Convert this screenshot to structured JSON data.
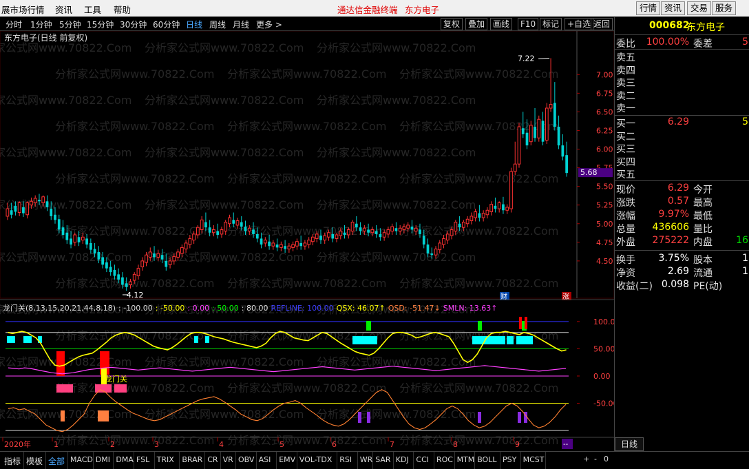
{
  "menu": {
    "items": [
      "展市场行情",
      "资讯",
      "工具",
      "帮助"
    ],
    "center_title": "通达信金融终端",
    "center_stock": "东方电子",
    "right_buttons": [
      "行情",
      "资讯",
      "交易",
      "服务"
    ]
  },
  "toolbar": {
    "periods": [
      "分时",
      "1分钟",
      "5分钟",
      "15分钟",
      "30分钟",
      "60分钟",
      "日线",
      "周线",
      "月线",
      "更多 >"
    ],
    "active_period": "日线",
    "tools": [
      "复权",
      "叠加",
      "画线",
      "F10",
      "标记",
      "+自选",
      "返回"
    ]
  },
  "chart": {
    "title": "东方电子(日线 前复权)",
    "watermark": "分析家公式网www.70822.Com",
    "price_high_label": "7.22",
    "price_low_label": "4.12",
    "price_axis": [
      "7.00",
      "6.75",
      "6.50",
      "6.25",
      "6.00",
      "5.75",
      "5.50",
      "5.25",
      "5.00",
      "4.75",
      "4.50"
    ],
    "current_price_tag": "5.68",
    "markers": {
      "cai": "财",
      "zhang": "涨"
    },
    "ind_name": "龙门关(8,13,15,20,21,44,8,18)",
    "ind_vals": [
      {
        "text": ": -100.00",
        "color": "#dddddd"
      },
      {
        "text": ": -50.00",
        "color": "#ffff00"
      },
      {
        "text": ": 0.00",
        "color": "#ff40ff"
      },
      {
        "text": ": 50.00",
        "color": "#00ff00"
      },
      {
        "text": ": 80.00",
        "color": "#dddddd"
      },
      {
        "text": "REFLINE: 100.00",
        "color": "#4040ff"
      },
      {
        "text": "QSX: 46.07↑",
        "color": "#ffff00"
      },
      {
        "text": "QSD: -51.47↓",
        "color": "#ff8040"
      },
      {
        "text": "SMLN: 13.63↑",
        "color": "#ff40ff"
      }
    ],
    "ind_axis": [
      "100.0",
      "50.00",
      "0.00",
      "-50.00"
    ],
    "ind_annotation": "龙门关",
    "time_axis": [
      "2020年",
      "1",
      "2",
      "3",
      "4",
      "5",
      "6",
      "7",
      "8",
      "9"
    ],
    "period_button": "日线",
    "zoom_controls": [
      "+",
      "-",
      "0"
    ],
    "more_button": "--"
  },
  "chart_data": {
    "type": "candlestick",
    "price_range": [
      4.12,
      7.22
    ],
    "price_axis_ticks": [
      4.5,
      4.75,
      5.0,
      5.25,
      5.5,
      5.75,
      6.0,
      6.25,
      6.5,
      6.75,
      7.0
    ],
    "indicator_axis_ticks": [
      -50,
      0,
      50,
      100
    ],
    "candles": [
      [
        5.1,
        5.28,
        5.2
      ],
      [
        5.18,
        5.28,
        5.12
      ],
      [
        5.24,
        5.3,
        5.16
      ],
      [
        5.15,
        5.3,
        5.28
      ],
      [
        5.22,
        5.3,
        5.14
      ],
      [
        5.12,
        5.3,
        5.28
      ],
      [
        5.25,
        5.35,
        5.3
      ],
      [
        5.28,
        5.38,
        5.34
      ],
      [
        5.32,
        5.4,
        5.3
      ],
      [
        5.28,
        5.38,
        5.36
      ],
      [
        5.3,
        5.38,
        5.22
      ],
      [
        5.2,
        5.3,
        5.1
      ],
      [
        5.12,
        5.22,
        5.05
      ],
      [
        5.06,
        5.12,
        4.92
      ],
      [
        4.95,
        5.05,
        4.85
      ],
      [
        4.88,
        4.98,
        4.78
      ],
      [
        4.8,
        4.9,
        4.72
      ],
      [
        4.75,
        4.88,
        4.85
      ],
      [
        4.82,
        4.9,
        4.75
      ],
      [
        4.78,
        4.88,
        4.82
      ],
      [
        4.8,
        4.86,
        4.72
      ],
      [
        4.74,
        4.8,
        4.65
      ],
      [
        4.66,
        4.74,
        4.6
      ],
      [
        4.62,
        4.7,
        4.52
      ],
      [
        4.55,
        4.62,
        4.45
      ],
      [
        4.48,
        4.55,
        4.4
      ],
      [
        4.42,
        4.5,
        4.35
      ],
      [
        4.38,
        4.45,
        4.3
      ],
      [
        4.32,
        4.4,
        4.25
      ],
      [
        4.28,
        4.35,
        4.18
      ],
      [
        4.2,
        4.28,
        4.15
      ],
      [
        4.18,
        4.26,
        4.22
      ],
      [
        4.24,
        4.35,
        4.32
      ],
      [
        4.3,
        4.45,
        4.4
      ],
      [
        4.42,
        4.55,
        4.5
      ],
      [
        4.48,
        4.62,
        4.58
      ],
      [
        4.55,
        4.68,
        4.62
      ],
      [
        4.6,
        4.7,
        4.55
      ],
      [
        4.55,
        4.65,
        4.6
      ],
      [
        4.58,
        4.66,
        4.52
      ],
      [
        4.5,
        4.6,
        4.42
      ],
      [
        4.45,
        4.55,
        4.5
      ],
      [
        4.5,
        4.6,
        4.56
      ],
      [
        4.55,
        4.66,
        4.62
      ],
      [
        4.6,
        4.72,
        4.68
      ],
      [
        4.66,
        4.78,
        4.74
      ],
      [
        4.72,
        4.85,
        4.8
      ],
      [
        4.78,
        4.9,
        4.86
      ],
      [
        4.85,
        4.98,
        4.95
      ],
      [
        4.92,
        5.1,
        5.05
      ],
      [
        5.02,
        5.15,
        4.95
      ],
      [
        4.95,
        5.05,
        4.88
      ],
      [
        4.88,
        4.98,
        4.92
      ],
      [
        4.9,
        5.0,
        4.85
      ],
      [
        4.86,
        4.96,
        4.92
      ],
      [
        4.9,
        5.05,
        5.02
      ],
      [
        5.0,
        5.12,
        5.08
      ],
      [
        5.05,
        5.15,
        5.0
      ],
      [
        4.98,
        5.08,
        5.04
      ],
      [
        5.02,
        5.1,
        4.96
      ],
      [
        4.96,
        5.04,
        4.9
      ],
      [
        4.9,
        4.98,
        4.94
      ],
      [
        4.92,
        5.02,
        4.86
      ],
      [
        4.86,
        4.95,
        4.8
      ],
      [
        4.8,
        4.88,
        4.72
      ],
      [
        4.74,
        4.82,
        4.78
      ],
      [
        4.76,
        4.85,
        4.7
      ],
      [
        4.7,
        4.78,
        4.74
      ],
      [
        4.72,
        4.8,
        4.68
      ],
      [
        4.68,
        4.76,
        4.72
      ],
      [
        4.7,
        4.78,
        4.66
      ],
      [
        4.66,
        4.74,
        4.7
      ],
      [
        4.68,
        4.76,
        4.72
      ],
      [
        4.7,
        4.8,
        4.76
      ],
      [
        4.74,
        4.84,
        4.7
      ],
      [
        4.7,
        4.78,
        4.74
      ],
      [
        4.72,
        4.82,
        4.78
      ],
      [
        4.76,
        4.86,
        4.82
      ],
      [
        4.8,
        4.9,
        4.86
      ],
      [
        4.84,
        4.92,
        4.78
      ],
      [
        4.78,
        4.88,
        4.84
      ],
      [
        4.82,
        4.92,
        4.88
      ],
      [
        4.86,
        4.95,
        4.8
      ],
      [
        4.8,
        4.88,
        4.85
      ],
      [
        4.84,
        4.94,
        4.9
      ],
      [
        4.88,
        4.98,
        4.85
      ],
      [
        4.85,
        4.95,
        4.92
      ],
      [
        4.9,
        5.05,
        5.02
      ],
      [
        5.0,
        5.1,
        4.95
      ],
      [
        4.95,
        5.02,
        4.9
      ],
      [
        4.9,
        4.98,
        4.94
      ],
      [
        4.92,
        5.0,
        4.88
      ],
      [
        4.88,
        4.96,
        4.92
      ],
      [
        4.9,
        4.98,
        4.86
      ],
      [
        4.86,
        4.94,
        4.82
      ],
      [
        4.82,
        4.92,
        4.88
      ],
      [
        4.86,
        4.96,
        4.92
      ],
      [
        4.9,
        5.0,
        4.96
      ],
      [
        4.94,
        5.02,
        4.9
      ],
      [
        4.9,
        4.98,
        4.94
      ],
      [
        4.92,
        5.0,
        4.96
      ],
      [
        4.94,
        5.02,
        4.98
      ],
      [
        4.96,
        5.05,
        4.92
      ],
      [
        4.9,
        4.98,
        4.94
      ],
      [
        4.92,
        5.0,
        4.86
      ],
      [
        4.84,
        4.92,
        4.72
      ],
      [
        4.72,
        4.8,
        4.6
      ],
      [
        4.6,
        4.68,
        4.58
      ],
      [
        4.58,
        4.7,
        4.66
      ],
      [
        4.65,
        4.78,
        4.74
      ],
      [
        4.72,
        4.85,
        4.8
      ],
      [
        4.78,
        4.9,
        4.86
      ],
      [
        4.84,
        4.96,
        4.92
      ],
      [
        4.9,
        5.05,
        5.02
      ],
      [
        5.0,
        5.1,
        4.95
      ],
      [
        4.95,
        5.05,
        5.02
      ],
      [
        5.0,
        5.1,
        5.06
      ],
      [
        5.04,
        5.15,
        5.1
      ],
      [
        5.08,
        5.2,
        5.16
      ],
      [
        5.14,
        5.25,
        5.08
      ],
      [
        5.08,
        5.18,
        5.14
      ],
      [
        5.12,
        5.22,
        5.18
      ],
      [
        5.16,
        5.3,
        5.26
      ],
      [
        5.24,
        5.35,
        5.2
      ],
      [
        5.2,
        5.3,
        5.28
      ],
      [
        5.26,
        5.36,
        5.18
      ],
      [
        5.18,
        5.26,
        5.22
      ],
      [
        5.2,
        5.75,
        5.7
      ],
      [
        5.7,
        6.1,
        5.8
      ],
      [
        5.8,
        6.35,
        6.3
      ],
      [
        6.28,
        6.5,
        6.2
      ],
      [
        6.22,
        6.4,
        6.05
      ],
      [
        6.1,
        6.38,
        6.32
      ],
      [
        6.3,
        6.55,
        6.15
      ],
      [
        6.15,
        6.45,
        6.4
      ],
      [
        6.38,
        6.5,
        6.1
      ],
      [
        6.12,
        6.62,
        6.55
      ],
      [
        6.55,
        7.22,
        6.6
      ],
      [
        6.62,
        6.9,
        6.3
      ],
      [
        6.3,
        6.45,
        6.05
      ],
      [
        6.05,
        6.2,
        5.9
      ],
      [
        5.92,
        6.1,
        5.68
      ]
    ],
    "qsx_line": [
      80,
      78,
      80,
      82,
      80,
      75,
      70,
      60,
      45,
      30,
      20,
      18,
      20,
      25,
      30,
      35,
      38,
      40,
      42,
      48,
      55,
      62,
      70,
      75,
      78,
      80,
      78,
      75,
      70,
      65,
      60,
      55,
      52,
      50,
      48,
      52,
      58,
      65,
      72,
      78,
      80,
      80,
      78,
      75,
      72,
      70,
      68,
      65,
      62,
      60,
      58,
      56,
      54,
      52,
      55,
      60,
      70,
      78,
      82,
      80,
      75,
      70,
      68,
      66,
      65,
      70,
      75,
      80,
      78,
      72,
      66,
      60,
      55,
      50,
      45,
      42,
      40,
      38,
      42,
      50,
      60,
      70,
      78,
      80,
      80,
      78,
      75,
      70,
      72,
      75,
      78,
      80,
      78,
      75,
      72,
      60,
      45,
      30,
      25,
      30,
      40,
      55,
      70,
      78,
      80,
      80,
      82,
      80,
      78,
      76,
      80,
      78,
      75,
      70,
      65,
      60,
      55,
      50,
      46,
      48
    ],
    "smln_line": [
      15,
      14,
      13,
      15,
      14,
      12,
      10,
      8,
      6,
      5,
      4,
      5,
      6,
      8,
      10,
      12,
      13,
      14,
      15,
      16,
      15,
      14,
      13,
      12,
      11,
      12,
      13,
      14,
      15,
      14,
      13,
      12,
      11,
      10,
      9,
      10,
      11,
      12,
      13,
      14,
      15,
      16,
      15,
      14,
      13,
      12,
      11,
      10,
      9,
      8,
      9,
      10,
      11,
      12,
      13,
      14,
      15,
      16,
      17,
      16,
      15,
      14,
      13,
      12,
      11,
      12,
      13,
      14,
      15,
      16,
      17,
      18,
      17,
      16,
      15,
      14,
      13,
      12,
      11,
      10,
      11,
      12,
      13,
      14,
      15,
      16,
      17,
      18,
      19,
      18,
      17,
      16,
      15,
      14,
      13,
      12,
      11,
      10,
      9,
      10,
      11,
      12,
      13,
      14
    ],
    "qsd_line": [
      -60,
      -58,
      -62,
      -60,
      -65,
      -70,
      -80,
      -90,
      -95,
      -100,
      -102,
      -98,
      -90,
      -80,
      -70,
      -50,
      -35,
      -25,
      -30,
      -40,
      -48,
      -55,
      -62,
      -68,
      -72,
      -76,
      -80,
      -82,
      -80,
      -75,
      -70,
      -65,
      -60,
      -55,
      -50,
      -45,
      -42,
      -40,
      -38,
      -42,
      -48,
      -55,
      -62,
      -70,
      -75,
      -80,
      -82,
      -78,
      -70,
      -62,
      -55,
      -50,
      -48,
      -45,
      -50,
      -58,
      -65,
      -72,
      -80,
      -86,
      -90,
      -92,
      -88,
      -80,
      -70,
      -60,
      -50,
      -40,
      -30,
      -25,
      -30,
      -45,
      -60,
      -75,
      -88,
      -95,
      -98,
      -95,
      -88,
      -80,
      -70,
      -60,
      -55,
      -60,
      -70,
      -82,
      -90,
      -95,
      -92,
      -85,
      -75,
      -65,
      -55,
      -50,
      -55,
      -65,
      -78,
      -90,
      -95,
      -92,
      -85,
      -75,
      -62,
      -52
    ]
  },
  "panel": {
    "code": "000682",
    "name": "东方电子",
    "weibi_label": "委比",
    "weibi_val": "100.00%",
    "weicha_label": "委差",
    "weicha_val": "5",
    "sells": [
      "卖五",
      "卖四",
      "卖三",
      "卖二",
      "卖一"
    ],
    "buys": [
      {
        "label": "买一",
        "price": "6.29",
        "vol": "5"
      },
      {
        "label": "买二",
        "price": "",
        "vol": ""
      },
      {
        "label": "买三",
        "price": "",
        "vol": ""
      },
      {
        "label": "买四",
        "price": "",
        "vol": ""
      },
      {
        "label": "买五",
        "price": "",
        "vol": ""
      }
    ],
    "stats": [
      {
        "l1": "现价",
        "v1": "6.29",
        "c1": "#ff4040",
        "l2": "今开",
        "v2": ""
      },
      {
        "l1": "涨跌",
        "v1": "0.57",
        "c1": "#ff4040",
        "l2": "最高",
        "v2": ""
      },
      {
        "l1": "涨幅",
        "v1": "9.97%",
        "c1": "#ff4040",
        "l2": "最低",
        "v2": ""
      },
      {
        "l1": "总量",
        "v1": "436606",
        "c1": "#ffff00",
        "l2": "量比",
        "v2": ""
      },
      {
        "l1": "外盘",
        "v1": "275222",
        "c1": "#ff4040",
        "l2": "内盘",
        "v2": "16"
      }
    ],
    "stats2": [
      {
        "l1": "换手",
        "v1": "3.75%",
        "l2": "股本",
        "v2": "1"
      },
      {
        "l1": "净资",
        "v1": "2.69",
        "l2": "流通",
        "v2": "1"
      },
      {
        "l1": "收益(二)",
        "v1": "0.098",
        "l2": "PE(动)",
        "v2": ""
      }
    ]
  },
  "tabs": {
    "items": [
      "指标",
      "模板",
      "全部",
      "MACD",
      "DMI",
      "DMA",
      "FSL",
      "TRIX",
      "BRAR",
      "CR",
      "VR",
      "OBV",
      "ASI",
      "EMV",
      "VOL-TDX",
      "RSI",
      "WR",
      "SAR",
      "KDJ",
      "CCI",
      "ROC",
      "MTM",
      "BOLL",
      "PSY",
      "MCST"
    ],
    "active": "全部"
  },
  "colors": {
    "up": "#ff3232",
    "down": "#00d2d2",
    "background": "#000000"
  }
}
